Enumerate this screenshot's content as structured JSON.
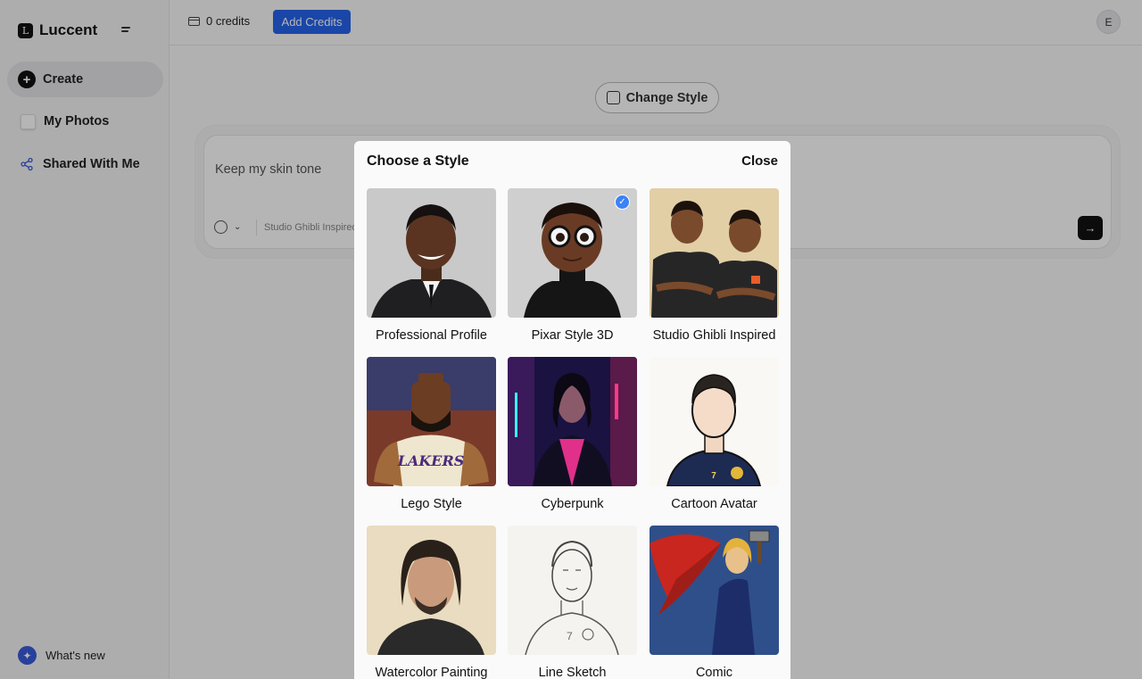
{
  "app": {
    "name": "Luccent",
    "logo_letter": "L"
  },
  "sidebar": {
    "items": [
      {
        "label": "Create",
        "icon": "plus-circle-icon",
        "active": true
      },
      {
        "label": "My Photos",
        "icon": "photos-icon"
      },
      {
        "label": "Shared With Me",
        "icon": "share-icon"
      }
    ],
    "whats_new": "What's new"
  },
  "topbar": {
    "credits": "0 credits",
    "add_credits": "Add Credits",
    "avatar_initial": "E"
  },
  "main": {
    "change_style_label": "Change Style",
    "prompt_value": "Keep my skin tone",
    "selected_style_chip": "Studio Ghibli Inspired"
  },
  "modal": {
    "title": "Choose a Style",
    "close_label": "Close",
    "styles": [
      {
        "label": "Professional Profile",
        "selected": false
      },
      {
        "label": "Pixar Style 3D",
        "selected": true
      },
      {
        "label": "Studio Ghibli Inspired",
        "selected": false
      },
      {
        "label": "Lego Style",
        "selected": false
      },
      {
        "label": "Cyberpunk",
        "selected": false
      },
      {
        "label": "Cartoon Avatar",
        "selected": false
      },
      {
        "label": "Watercolor Painting",
        "selected": false
      },
      {
        "label": "Line Sketch",
        "selected": false
      },
      {
        "label": "Comic",
        "selected": false
      }
    ]
  },
  "colors": {
    "accent": "#2563eb",
    "check": "#3b82f6",
    "overlay": "rgba(0,0,0,0.29)"
  }
}
